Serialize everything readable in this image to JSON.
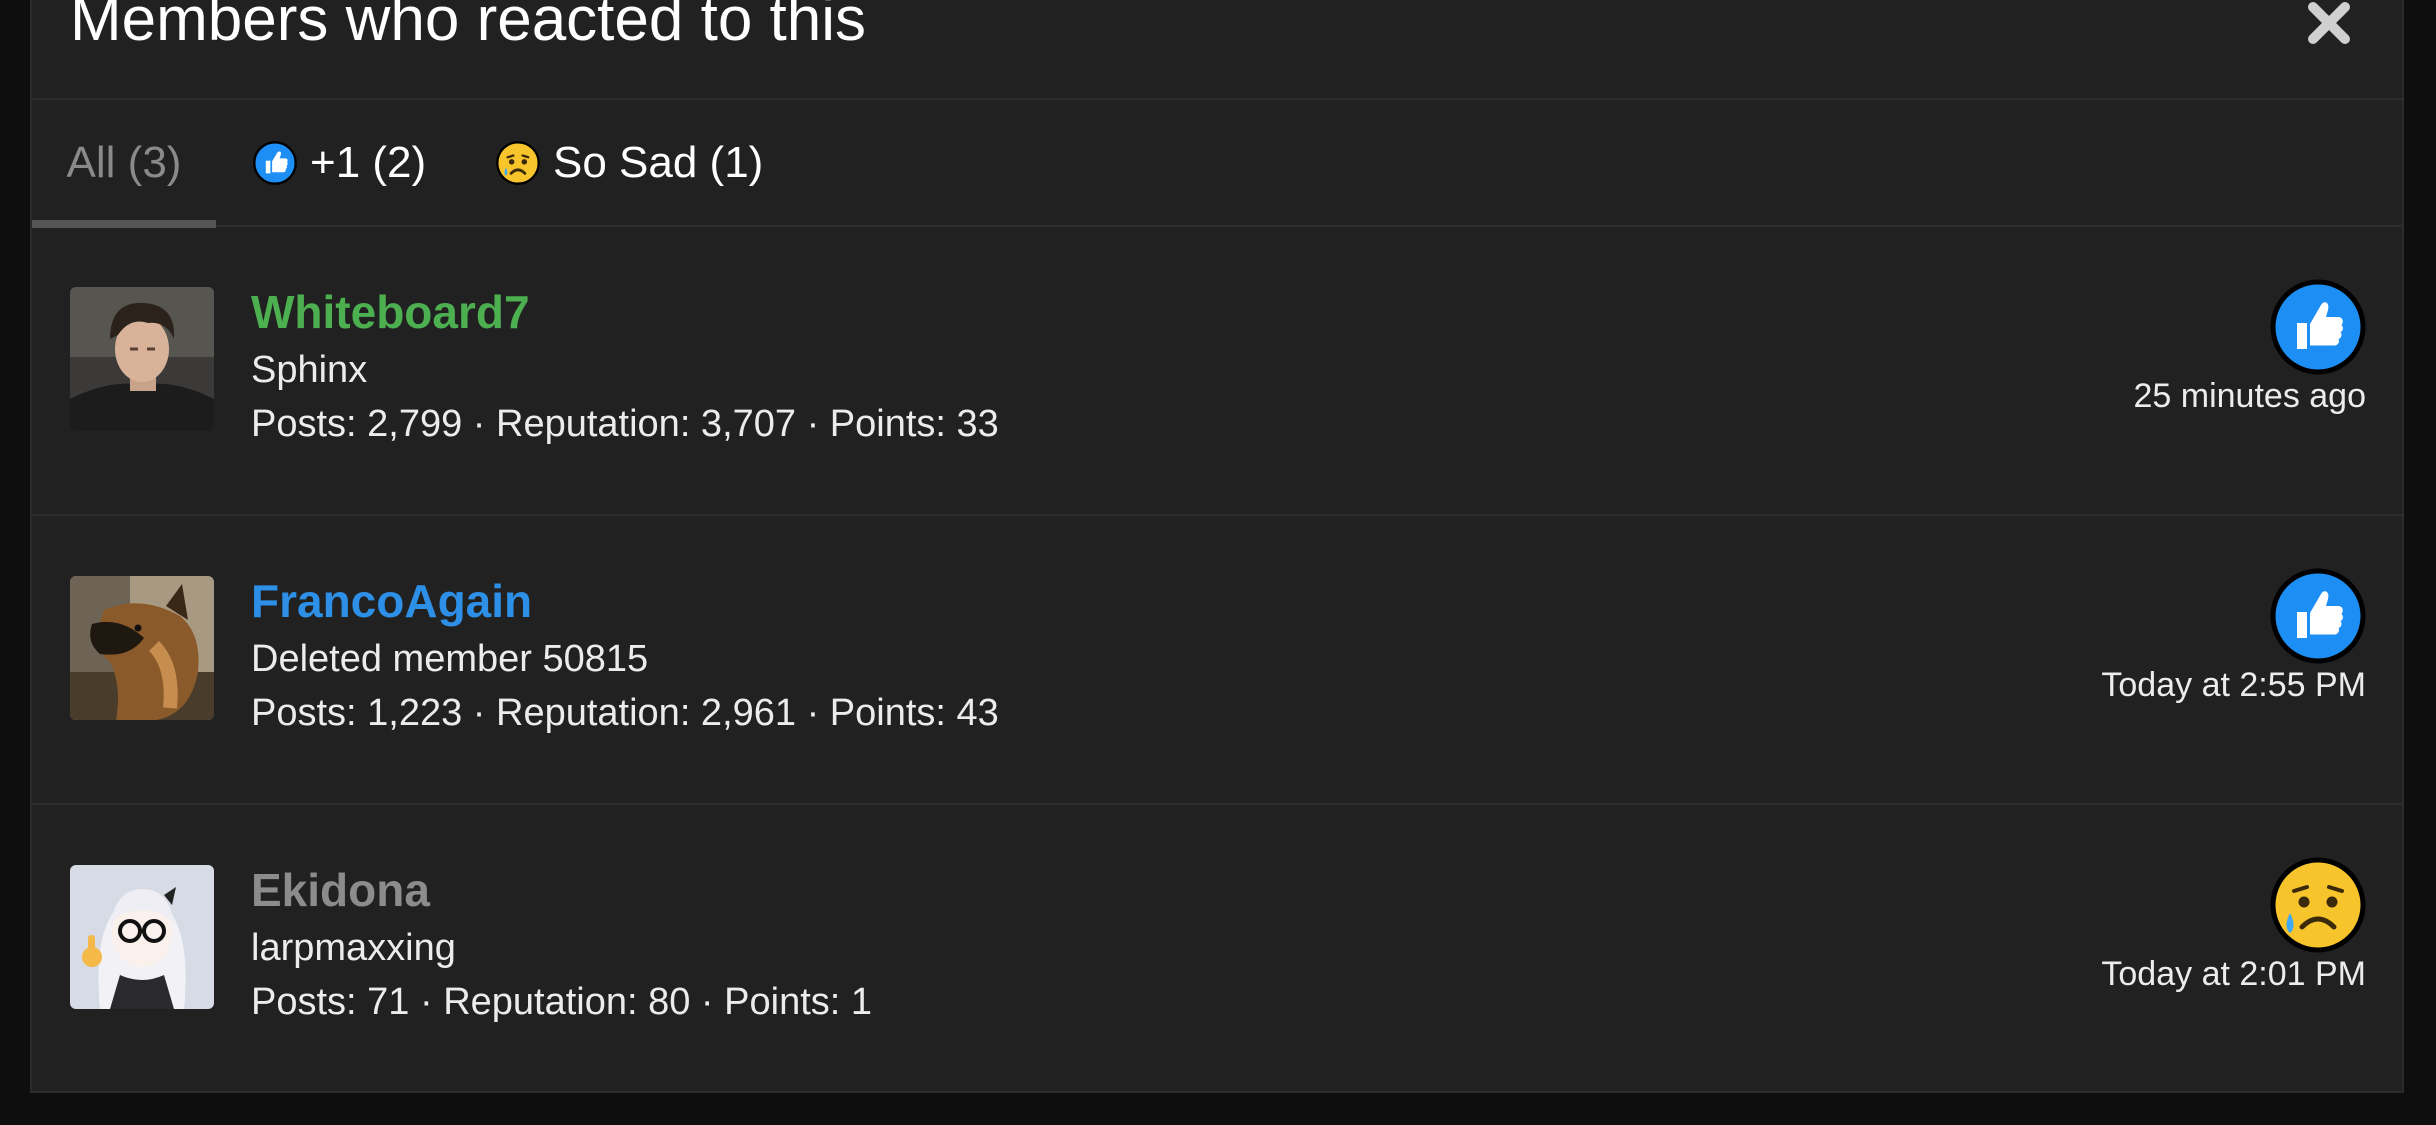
{
  "modal": {
    "title": "Members who reacted to this"
  },
  "tabs": [
    {
      "label": "All (3)"
    },
    {
      "label": "+1 (2)"
    },
    {
      "label": "So Sad (1)"
    }
  ],
  "colors": {
    "background": "#212121",
    "username_green": "#4caf50",
    "username_blue": "#2d8fe6",
    "username_gray": "#8c8c8c",
    "like_blue": "#1877f2",
    "sad_yellow": "#f7c52b"
  },
  "members": [
    {
      "username": "Whiteboard7",
      "user_title": "Sphinx",
      "stats": "Posts: 2,799 · Reputation: 3,707 · Points: 33",
      "reaction": "thumbs-up",
      "time": "25 minutes ago"
    },
    {
      "username": "FrancoAgain",
      "user_title": "Deleted member 50815",
      "stats": "Posts: 1,223 · Reputation: 2,961 · Points: 43",
      "reaction": "thumbs-up",
      "time": "Today at 2:55 PM"
    },
    {
      "username": "Ekidona",
      "user_title": "larpmaxxing",
      "stats": "Posts: 71 · Reputation: 80 · Points: 1",
      "reaction": "sad-face",
      "time": "Today at 2:01 PM"
    }
  ]
}
